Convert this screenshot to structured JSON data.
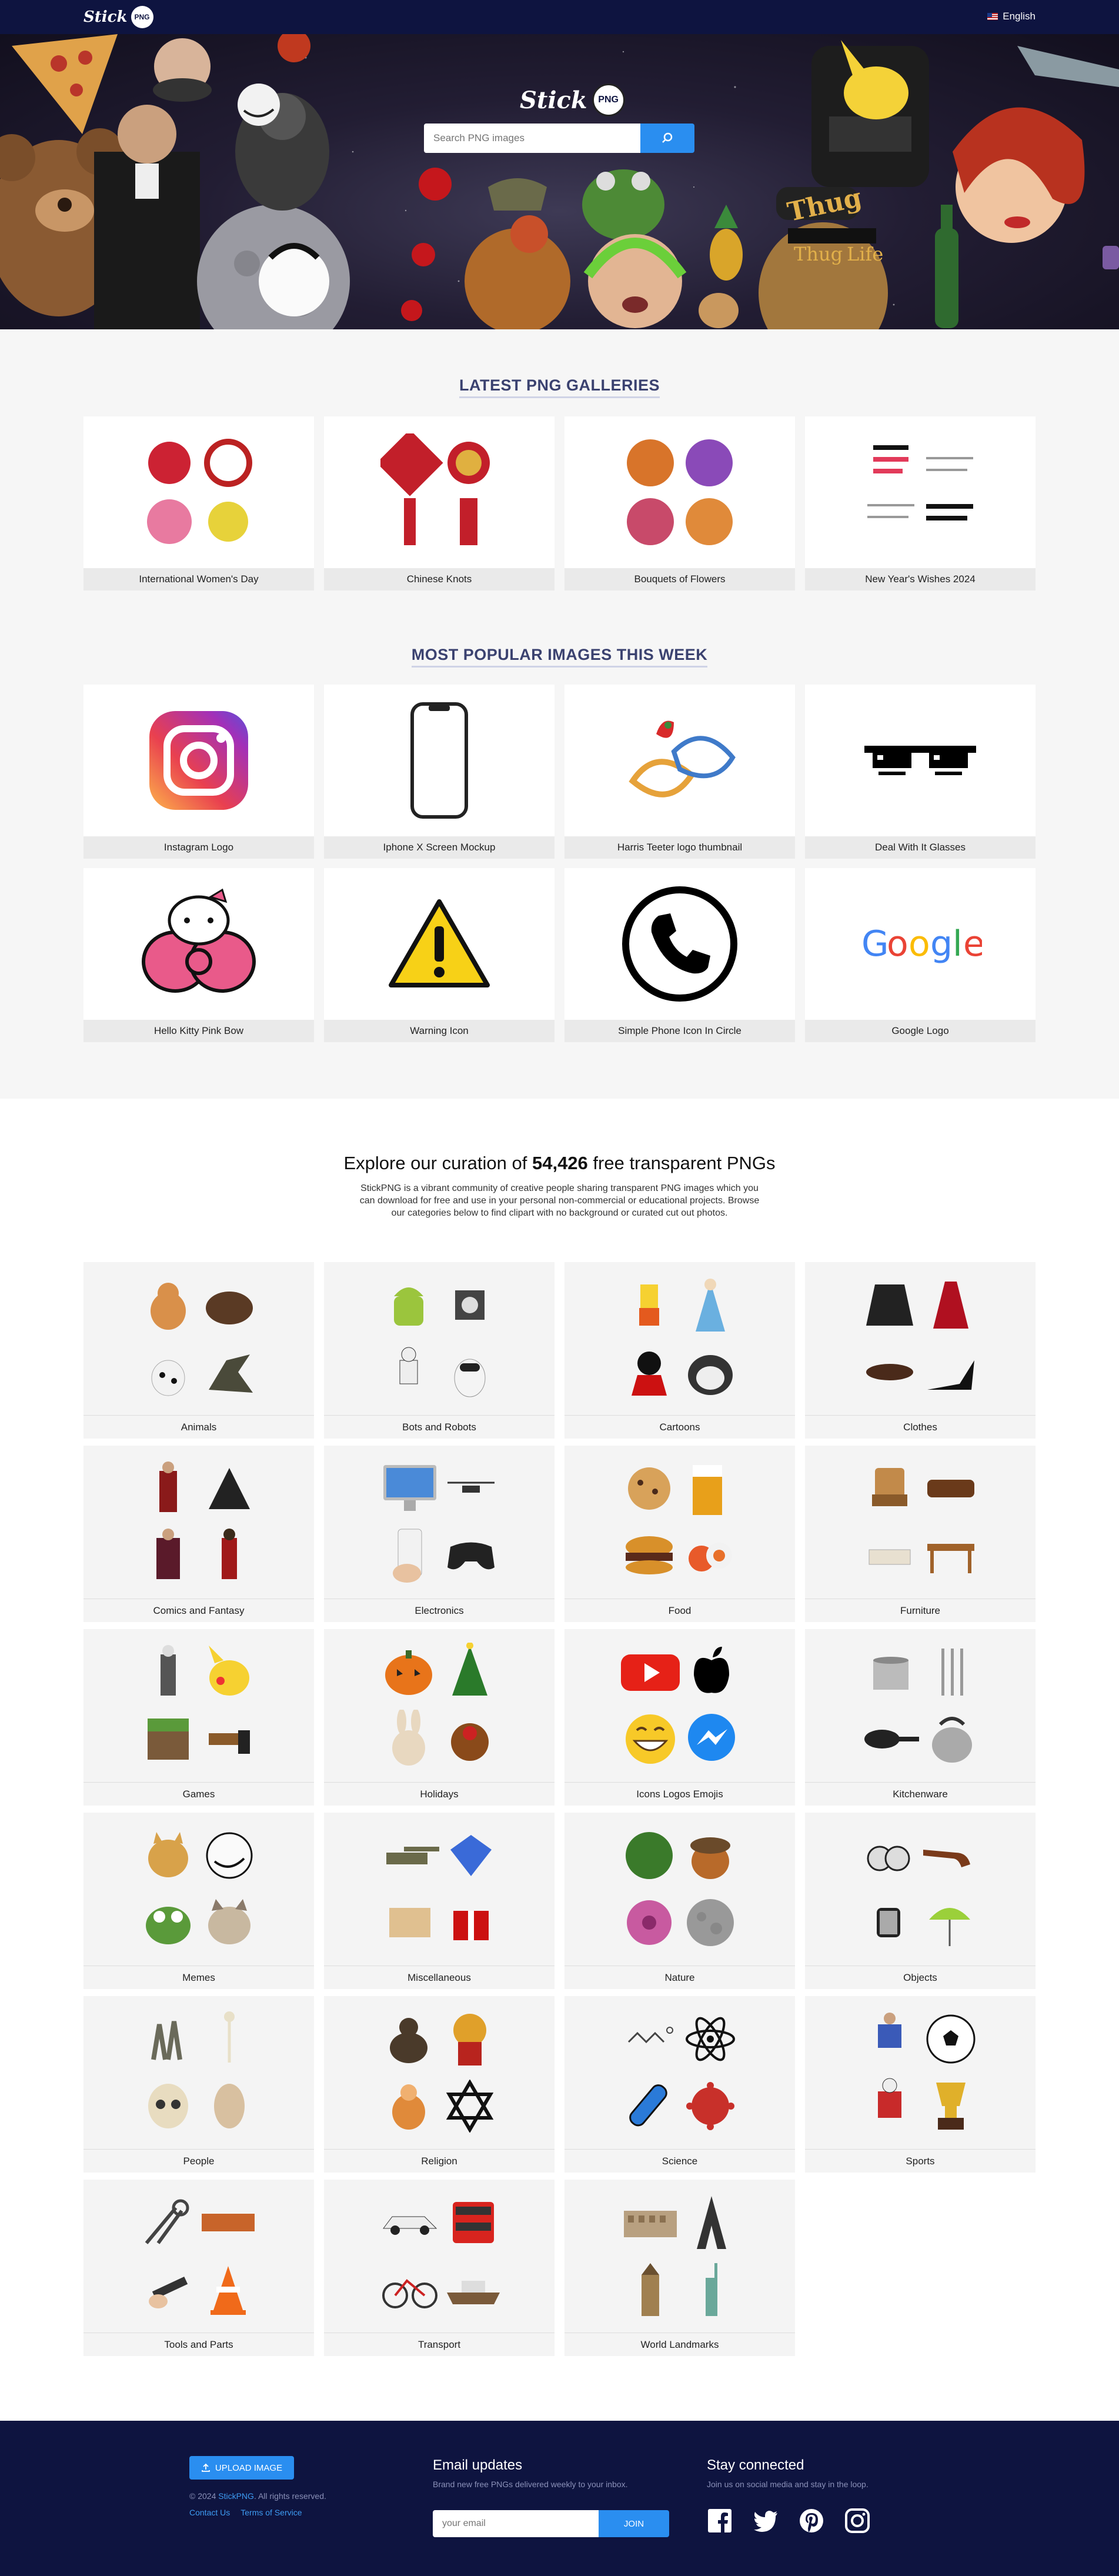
{
  "nav": {
    "logo_text": "Stick",
    "logo_badge": "PNG",
    "language": "English"
  },
  "hero": {
    "logo_text": "Stick",
    "logo_badge": "PNG",
    "search_placeholder": "Search PNG images",
    "thug_text_1": "Thug",
    "thug_text_2": "Thug",
    "thug_text_3": "Life"
  },
  "galleries": {
    "title": "LATEST PNG GALLERIES",
    "items": [
      {
        "label": "International Women's Day"
      },
      {
        "label": "Chinese Knots"
      },
      {
        "label": "Bouquets of Flowers"
      },
      {
        "label": "New Year's Wishes 2024"
      }
    ]
  },
  "popular": {
    "title": "MOST POPULAR IMAGES THIS WEEK",
    "items": [
      {
        "label": "Instagram Logo"
      },
      {
        "label": "Iphone X Screen Mockup"
      },
      {
        "label": "Harris Teeter logo thumbnail"
      },
      {
        "label": "Deal With It Glasses"
      },
      {
        "label": "Hello Kitty Pink Bow"
      },
      {
        "label": "Warning Icon"
      },
      {
        "label": "Simple Phone Icon In Circle"
      },
      {
        "label": "Google Logo"
      }
    ]
  },
  "explore": {
    "heading_pre": "Explore our curation of ",
    "count": "54,426",
    "heading_post": " free transparent PNGs",
    "description": "StickPNG is a vibrant community of creative people sharing transparent PNG images which you can download for free and use in your personal non-commercial or educational projects. Browse our categories below to find clipart with no background or curated cut out photos."
  },
  "categories": [
    {
      "label": "Animals"
    },
    {
      "label": "Bots and Robots"
    },
    {
      "label": "Cartoons"
    },
    {
      "label": "Clothes"
    },
    {
      "label": "Comics and Fantasy"
    },
    {
      "label": "Electronics"
    },
    {
      "label": "Food"
    },
    {
      "label": "Furniture"
    },
    {
      "label": "Games"
    },
    {
      "label": "Holidays"
    },
    {
      "label": "Icons Logos Emojis"
    },
    {
      "label": "Kitchenware"
    },
    {
      "label": "Memes"
    },
    {
      "label": "Miscellaneous"
    },
    {
      "label": "Nature"
    },
    {
      "label": "Objects"
    },
    {
      "label": "People"
    },
    {
      "label": "Religion"
    },
    {
      "label": "Science"
    },
    {
      "label": "Sports"
    },
    {
      "label": "Tools and Parts"
    },
    {
      "label": "Transport"
    },
    {
      "label": "World Landmarks"
    }
  ],
  "footer": {
    "upload_label": "UPLOAD IMAGE",
    "copyright_pre": "© 2024 ",
    "copyright_brand": "StickPNG",
    "copyright_post": ". All rights reserved.",
    "contact": "Contact Us",
    "terms": "Terms of Service",
    "email_title": "Email updates",
    "email_sub": "Brand new free PNGs delivered weekly to your inbox.",
    "email_placeholder": "your email",
    "join_label": "JOIN",
    "social_title": "Stay connected",
    "social_sub": "Join us on social media and stay in the loop."
  },
  "colors": {
    "nav_bg": "#0e1440",
    "accent": "#2a8ef0",
    "title": "#3b4270"
  }
}
